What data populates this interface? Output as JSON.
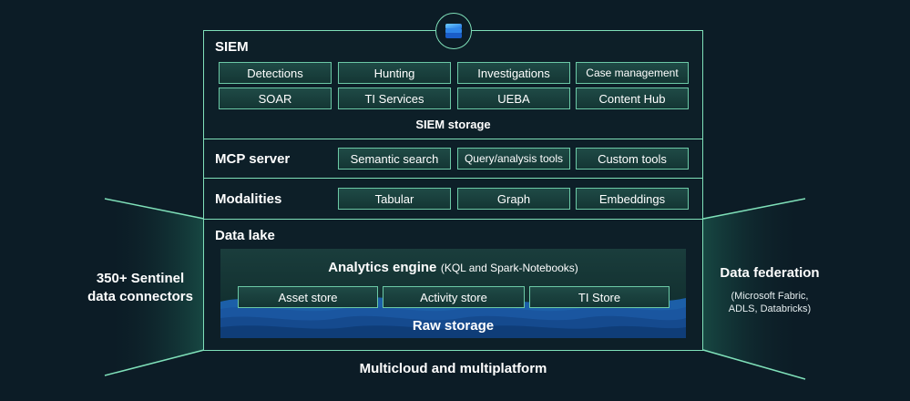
{
  "siem": {
    "title": "SIEM",
    "row1": [
      "Detections",
      "Hunting",
      "Investigations",
      "Case management"
    ],
    "row2": [
      "SOAR",
      "TI Services",
      "UEBA",
      "Content Hub"
    ],
    "storage": "SIEM storage"
  },
  "mcp": {
    "title": "MCP server",
    "items": [
      "Semantic search",
      "Query/analysis tools",
      "Custom tools"
    ]
  },
  "modalities": {
    "title": "Modalities",
    "items": [
      "Tabular",
      "Graph",
      "Embeddings"
    ]
  },
  "datalake": {
    "title": "Data lake",
    "analytics_title": "Analytics engine",
    "analytics_sub": "(KQL and Spark-Notebooks)",
    "stores": [
      "Asset store",
      "Activity store",
      "TI Store"
    ],
    "raw": "Raw storage"
  },
  "left": {
    "line1": "350+ Sentinel",
    "line2": "data connectors"
  },
  "right": {
    "title": "Data federation",
    "sub1": "(Microsoft Fabric,",
    "sub2": "ADLS, Databricks)"
  },
  "bottom": "Multicloud and multiplatform",
  "logo_icon": "copilot-logo-icon",
  "colors": {
    "background": "#0c1c26",
    "accent": "#7fe0b9",
    "chip": "#1a4240",
    "water": "#1a62b5"
  }
}
